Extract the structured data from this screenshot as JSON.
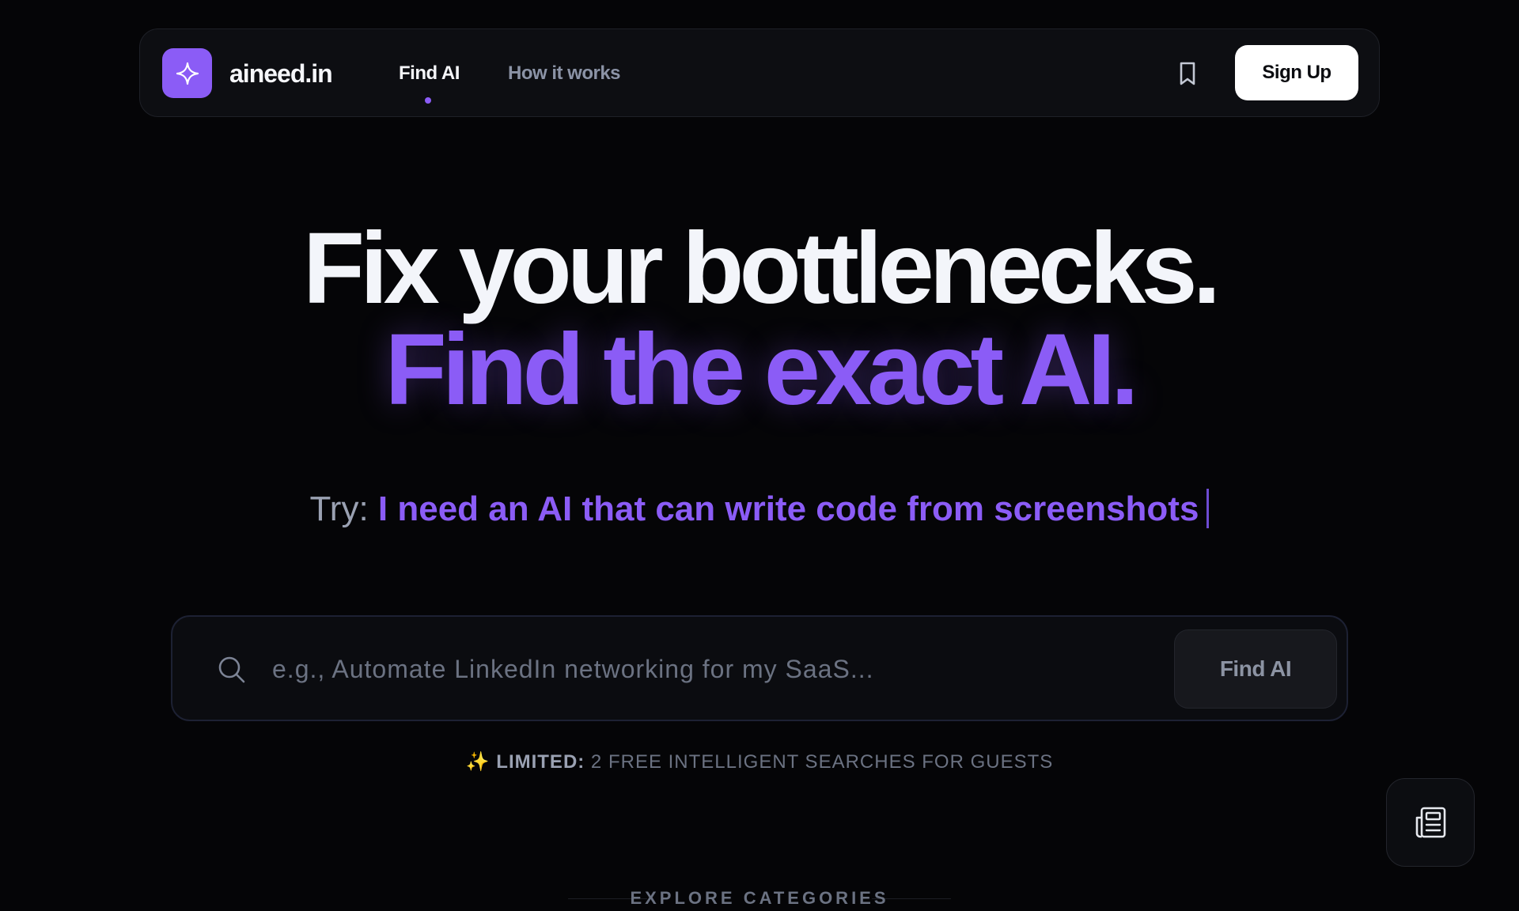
{
  "nav": {
    "brand": "aineed.in",
    "links": [
      {
        "label": "Find AI",
        "active": true
      },
      {
        "label": "How it works",
        "active": false
      }
    ],
    "bookmark_icon": "bookmark-icon",
    "signup_label": "Sign Up"
  },
  "hero": {
    "line1": "Fix your bottlenecks.",
    "line2": "Find the exact AI.",
    "try_label": "Try: ",
    "try_example": "I need an AI that can write code from screenshots"
  },
  "search": {
    "placeholder": "e.g., Automate LinkedIn networking for my SaaS...",
    "value": "",
    "button_label": "Find AI"
  },
  "notice": {
    "spark": "✨",
    "strong": "LIMITED:",
    "rest": " 2 FREE INTELLIGENT SEARCHES FOR GUESTS"
  },
  "explore": {
    "label": "EXPLORE CATEGORIES"
  },
  "colors": {
    "accent": "#8b5cf6",
    "background": "#050507",
    "panel": "#0d0e12"
  }
}
